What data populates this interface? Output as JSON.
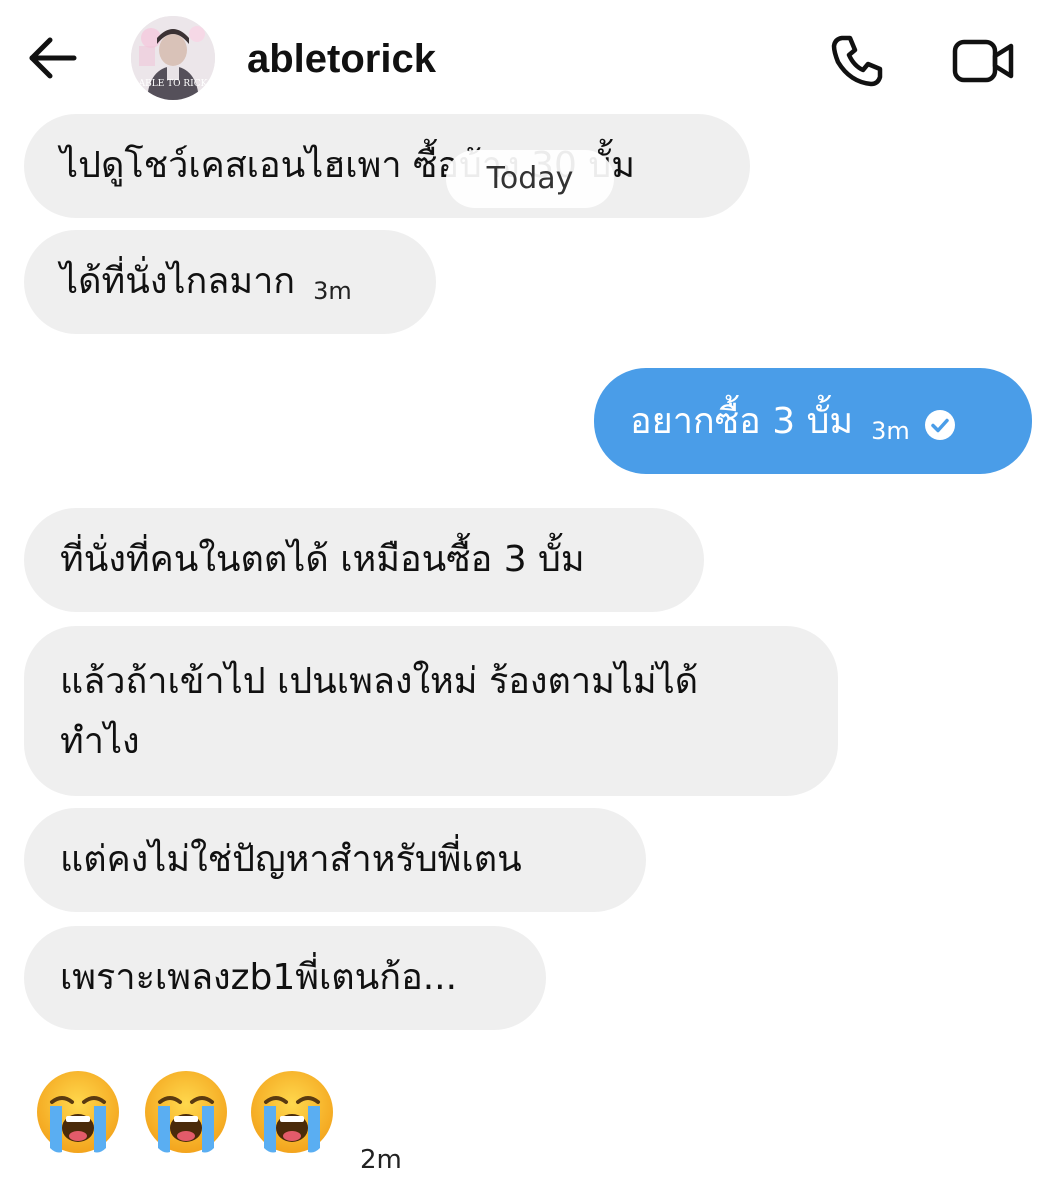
{
  "header": {
    "username": "abletorick",
    "avatar_caption": "ABLE TO RICK",
    "back_icon": "arrow-left-icon",
    "call_icon": "phone-icon",
    "video_icon": "video-camera-icon"
  },
  "date_divider": "Today",
  "messages": [
    {
      "from": "them",
      "text": "ไปดูโชว์เคสเอนไฮเพา ซื้อบ้าง 30 บั้ม",
      "time": ""
    },
    {
      "from": "them",
      "text": "ได้ที่นั่งไกลมาก",
      "time": "3m"
    },
    {
      "from": "me",
      "text": "อยากซื้อ 3 บั้ม",
      "time": "3m",
      "status": "seen"
    },
    {
      "from": "them",
      "text": "ที่นั่งที่คนในตตได้ เหมือนซื้อ 3 บั้ม",
      "time": ""
    },
    {
      "from": "them",
      "text_line1": "แล้วถ้าเข้าไป เปนเพลงใหม่ ร้องตามไม่ได้",
      "text_line2": "ทำไง",
      "time": ""
    },
    {
      "from": "them",
      "text": "แต่คงไม่ใช่ปัญหาสำหรับพี่เตน",
      "time": ""
    },
    {
      "from": "them",
      "text": "เพราะเพลงzb1พี่เตนก้อ...",
      "time": ""
    }
  ],
  "emoji_message": {
    "emojis": [
      "😭",
      "😭",
      "😭"
    ],
    "time": "2m"
  },
  "colors": {
    "incoming_bubble": "#efefef",
    "outgoing_bubble": "#4a9de8",
    "text": "#111111"
  }
}
